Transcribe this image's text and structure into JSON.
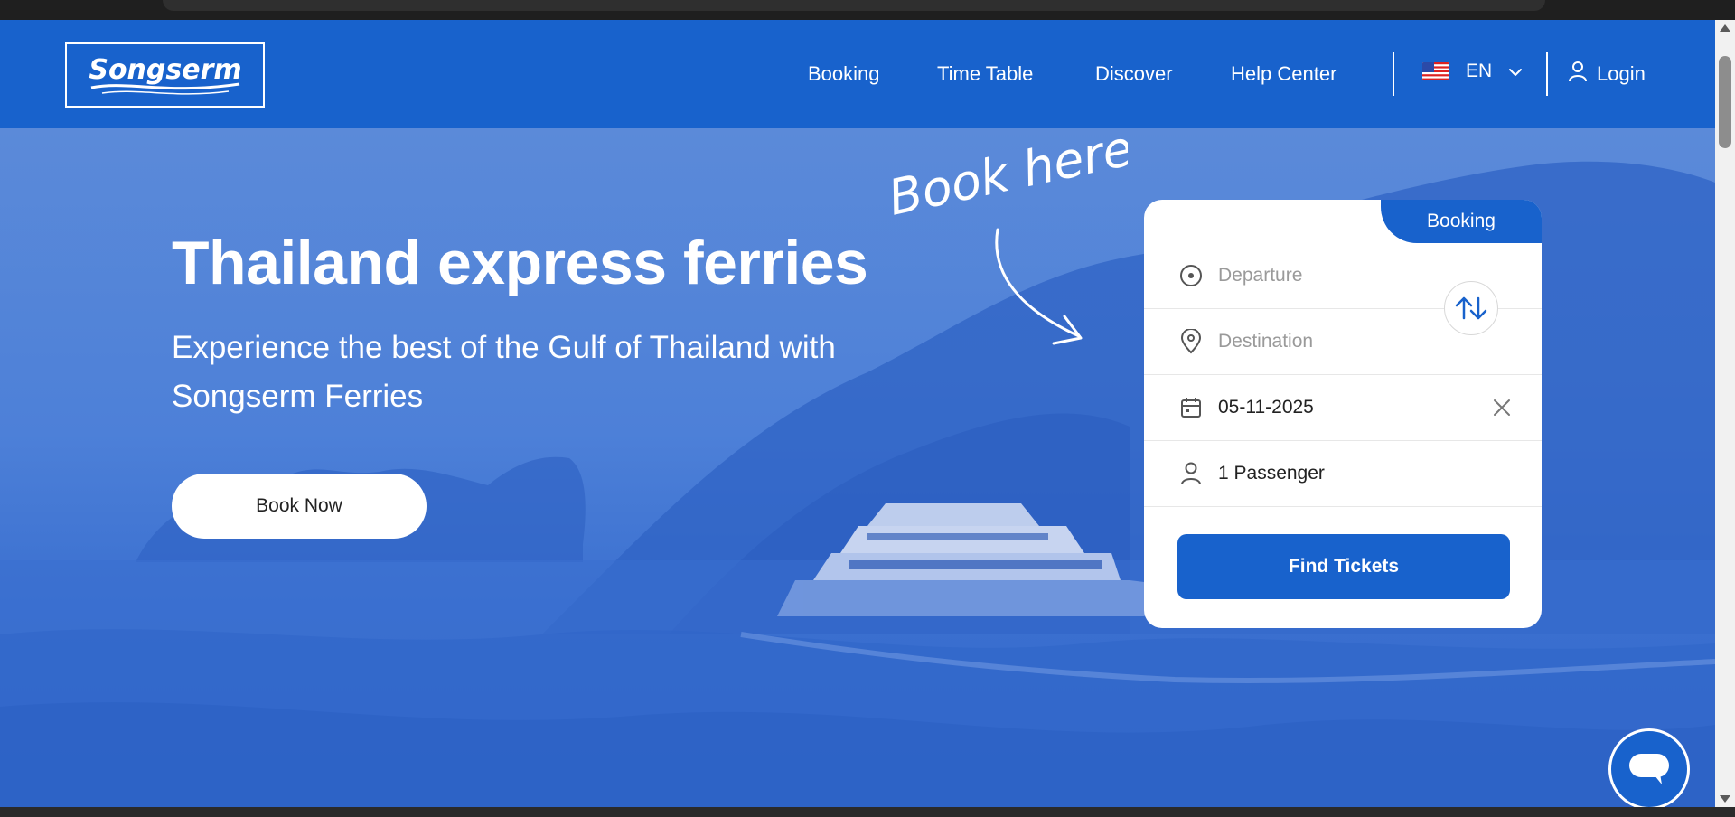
{
  "brand": {
    "logo_text": "Songserm",
    "accent": "#1862cc"
  },
  "nav": {
    "items": [
      {
        "label": "Booking"
      },
      {
        "label": "Time Table"
      },
      {
        "label": "Discover"
      },
      {
        "label": "Help Center"
      }
    ],
    "language": {
      "code": "EN",
      "flag": "us-flag-icon"
    },
    "login_label": "Login"
  },
  "hero": {
    "title": "Thailand express ferries",
    "subtitle": "Experience the best of the Gulf of Thailand with Songserm Ferries",
    "cta_label": "Book Now",
    "annotation": "Book here"
  },
  "booking": {
    "tab_label": "Booking",
    "departure_placeholder": "Departure",
    "destination_placeholder": "Destination",
    "date_value": "05-11-2025",
    "passengers_value": "1 Passenger",
    "submit_label": "Find Tickets"
  },
  "icons": {
    "departure": "target-icon",
    "destination": "location-pin-icon",
    "date": "calendar-icon",
    "passengers": "user-icon",
    "swap": "swap-arrows-icon",
    "clear": "close-icon",
    "chat": "chat-bubble-icon",
    "language_toggle": "chevron-down-icon"
  }
}
